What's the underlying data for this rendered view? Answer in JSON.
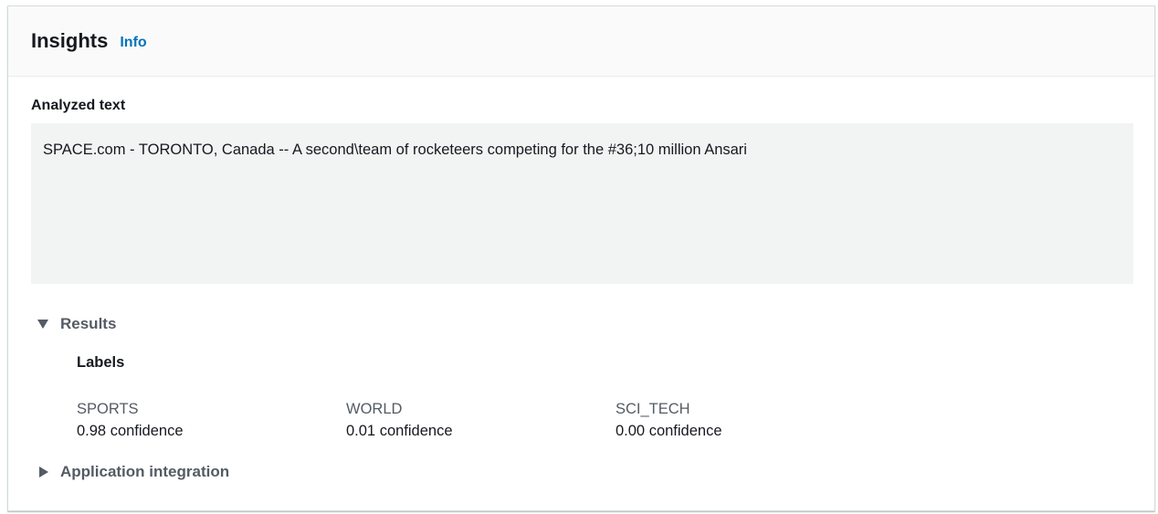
{
  "header": {
    "title": "Insights",
    "info_link": "Info"
  },
  "analyzed": {
    "label": "Analyzed text",
    "text": "SPACE.com - TORONTO, Canada -- A second\\team of rocketeers competing for the #36;10 million Ansari"
  },
  "results": {
    "label": "Results",
    "expanded": true,
    "labels_heading": "Labels",
    "labels": [
      {
        "name": "SPORTS",
        "confidence": "0.98 confidence"
      },
      {
        "name": "WORLD",
        "confidence": "0.01 confidence"
      },
      {
        "name": "SCI_TECH",
        "confidence": "0.00 confidence"
      }
    ]
  },
  "application_integration": {
    "label": "Application integration",
    "expanded": false
  },
  "colors": {
    "link": "#0073bb",
    "text_box_bg": "#f2f3f3",
    "header_bg": "#fafafa"
  },
  "icons": {
    "results_caret": "caret-down-icon",
    "appint_caret": "caret-right-icon"
  }
}
